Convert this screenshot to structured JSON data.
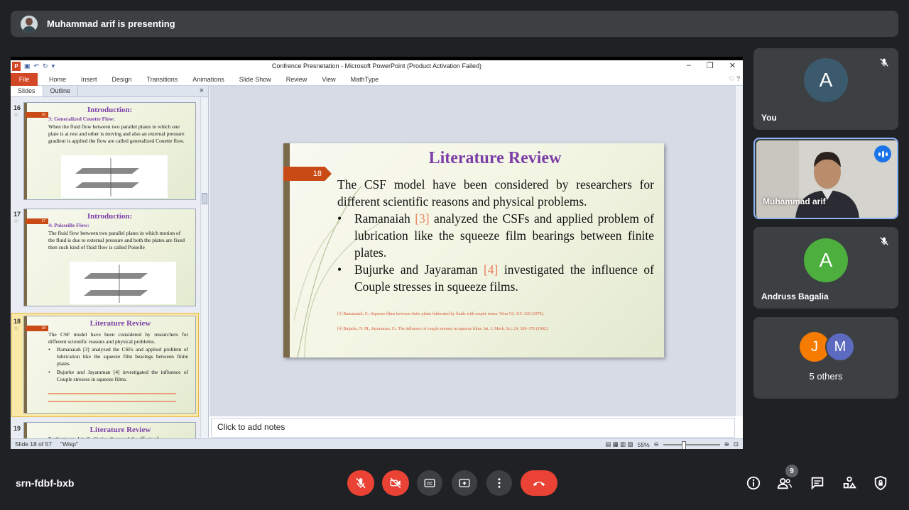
{
  "banner": {
    "presenting_text": "Muhammad arif is presenting"
  },
  "ppt": {
    "window_title": "Confrence Presnetation - Microsoft PowerPoint (Product Activation Failed)",
    "ribbon_tabs": [
      "File",
      "Home",
      "Insert",
      "Design",
      "Transitions",
      "Animations",
      "Slide Show",
      "Review",
      "View",
      "MathType"
    ],
    "pane_tabs": {
      "slides": "Slides",
      "outline": "Outline"
    },
    "thumbs": [
      {
        "number": "16",
        "slide_num": "16",
        "title": "Introduction:",
        "subtitle": "3: Generalized Couette Flow:",
        "body": "When the fluid flow between two parallel plates in which one plate is at rest and other is moving and also an external pressure gradient is applied the flow are called generalized Couette flow."
      },
      {
        "number": "17",
        "slide_num": "17",
        "title": "Introduction:",
        "subtitle": "4: Poisseille Flow:",
        "body": "The fluid flow between two parallel plates in which motion of the fluid is due to external pressure and both the plates are fixed then such kind of fluid flow is called Poiselle"
      },
      {
        "number": "18",
        "slide_num": "18",
        "title": "Literature Review",
        "body": "The CSF model have been considered by researchers for different scientific reasons and physical problems.",
        "bullet1": "Ramanaiah [3] analyzed the CSFs and applied problem of lubrication like the squeeze film bearings between finite plates.",
        "bullet2": "Bujurke and Jayaraman [4] investigated the influence of Couple stresses in squeeze films."
      },
      {
        "number": "19",
        "title": "Literature Review",
        "body": "Furthermore, Lin [5, 6] also discussed the effects of"
      }
    ],
    "slide": {
      "number": "18",
      "title": "Literature Review",
      "intro": "The CSF model have been considered by researchers for different scientific reasons and physical problems.",
      "b1_pre": "Ramanaiah ",
      "b1_cite": "[3]",
      "b1_post": " analyzed the CSFs and applied problem of lubrication like the squeeze film bearings between finite plates.",
      "b2_pre": "Bujurke and Jayaraman ",
      "b2_cite": "[4]",
      "b2_post": " investigated the influence of Couple stresses in squeeze films.",
      "ref1": "[3]  Ramanaiah, G.: Squeeze films between finite plates lubricated by fluids with couple stress. Wear 54, 315–320 (1979).",
      "ref2": "[4]  Bujurke, N. M., Jayaraman, G.: The influence of couple stresses in squeeze films. Int. J. Mech. Sci. 24, 369–376 (1982)."
    },
    "notes_placeholder": "Click to add notes",
    "status": {
      "slide_counter": "Slide 18 of 57",
      "theme": "\"Wisp\"",
      "zoom": "55%"
    }
  },
  "participants": [
    {
      "name": "You",
      "initial": "A",
      "color": "#3c5a6e"
    },
    {
      "name": "Muhammad arif"
    },
    {
      "name": "Andruss Bagalia",
      "initial": "A",
      "color": "#4caf3e"
    },
    {
      "name": "5 others",
      "initials": [
        "J",
        "M"
      ],
      "colors": [
        "#f57c00",
        "#5c6bc0"
      ]
    }
  ],
  "meeting": {
    "code": "srn-fdbf-bxb",
    "people_count": "9"
  },
  "colors": {
    "end_call": "#ea4335",
    "accent": "#8ab4f8",
    "slide_title": "#7c3fa8",
    "slide_badge": "#c94a14"
  },
  "icons": [
    "mic-off-icon",
    "camera-off-icon",
    "captions-icon",
    "present-icon",
    "more-icon",
    "end-call-icon",
    "info-icon",
    "people-icon",
    "chat-icon",
    "activities-icon",
    "host-controls-icon"
  ]
}
